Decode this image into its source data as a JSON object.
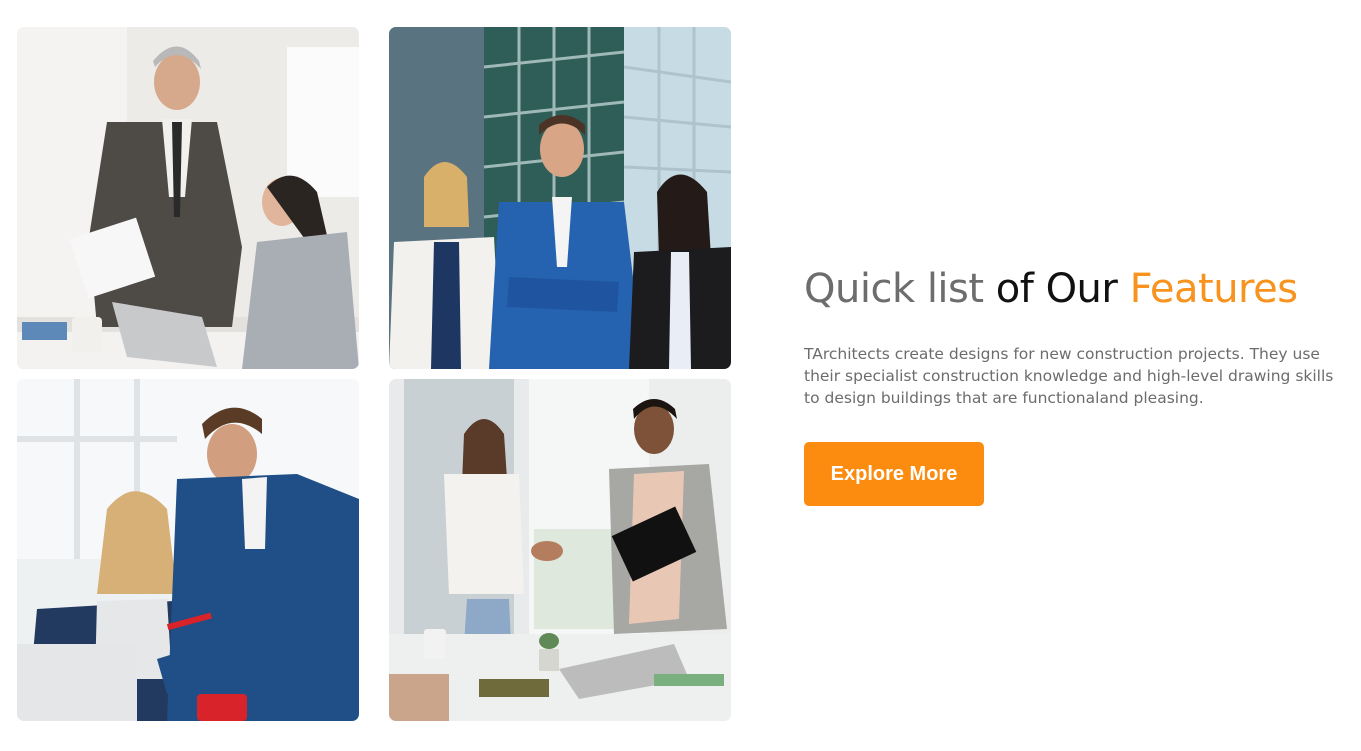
{
  "photos": [
    {
      "alt": "Senior businessman reviewing documents with colleague at desk"
    },
    {
      "alt": "Three business professionals standing in front of glass office building"
    },
    {
      "alt": "Businessman pointing at laptop screen with colleague"
    },
    {
      "alt": "Two colleagues shaking hands in office meeting room"
    }
  ],
  "feature": {
    "heading_part1": "Quick list",
    "heading_part2": "of Our",
    "heading_part3": "Features",
    "description": "TArchitects create designs for new construction projects. They use their specialist construction knowledge and high-level drawing skills to design buildings that are functionaland pleasing.",
    "button_label": "Explore More"
  },
  "colors": {
    "accent": "#fb8c0f",
    "heading_grey": "#6d6d6d",
    "heading_dark": "#111111",
    "body_text": "#6c6c6c"
  }
}
